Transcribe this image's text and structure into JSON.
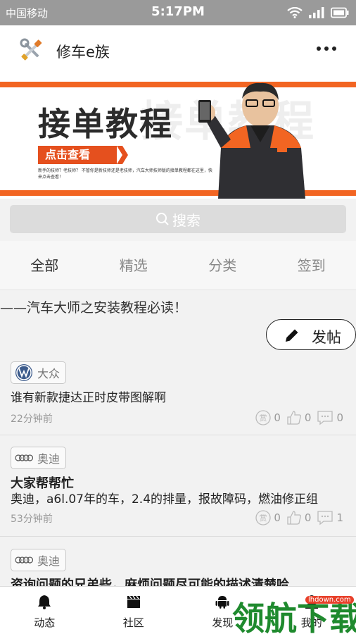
{
  "status_bar": {
    "carrier": "中国移动",
    "time": "5:17PM"
  },
  "header": {
    "title": "修车e族"
  },
  "banner": {
    "title": "接单教程",
    "cta": "点击查看",
    "description": "新手的技师？老技师？ 不管你是新技师还是老技师，汽车大师技师版的接单教程都在这里，快来点击查看！"
  },
  "search": {
    "placeholder": "搜索"
  },
  "tabs": [
    "全部",
    "精选",
    "分类",
    "签到"
  ],
  "notice": "——汽车大师之安装教程必读！",
  "post_button": {
    "label": "发帖"
  },
  "posts": [
    {
      "brand": "大众",
      "title": "",
      "text": "谁有新款捷达正时皮带图解啊",
      "time": "22分钟前",
      "reward": "0",
      "likes": "0",
      "comments": "0"
    },
    {
      "brand": "奥迪",
      "title": "大家帮帮忙",
      "text": "奥迪，a6l.07年的车，2.4的排量，报故障码，燃油修正组",
      "time": "53分钟前",
      "reward": "0",
      "likes": "0",
      "comments": "1"
    },
    {
      "brand": "奥迪",
      "title": "资询问题的兄弟些，麻烦问题尽可能的描述清楚哈",
      "text": "",
      "time": "",
      "reward": "",
      "likes": "",
      "comments": ""
    }
  ],
  "reward_glyph": "赏",
  "bottom_nav": [
    {
      "label": "动态",
      "icon": "bell-icon"
    },
    {
      "label": "社区",
      "icon": "clapperboard-icon"
    },
    {
      "label": "发现",
      "icon": "android-icon"
    },
    {
      "label": "我的",
      "icon": "user-icon"
    }
  ],
  "watermark": {
    "text": "领航下载",
    "url": "lhdown.com"
  },
  "colors": {
    "accent": "#f26522",
    "status_bar": "#9a9a9a",
    "watermark_green": "#1f8a2e"
  }
}
